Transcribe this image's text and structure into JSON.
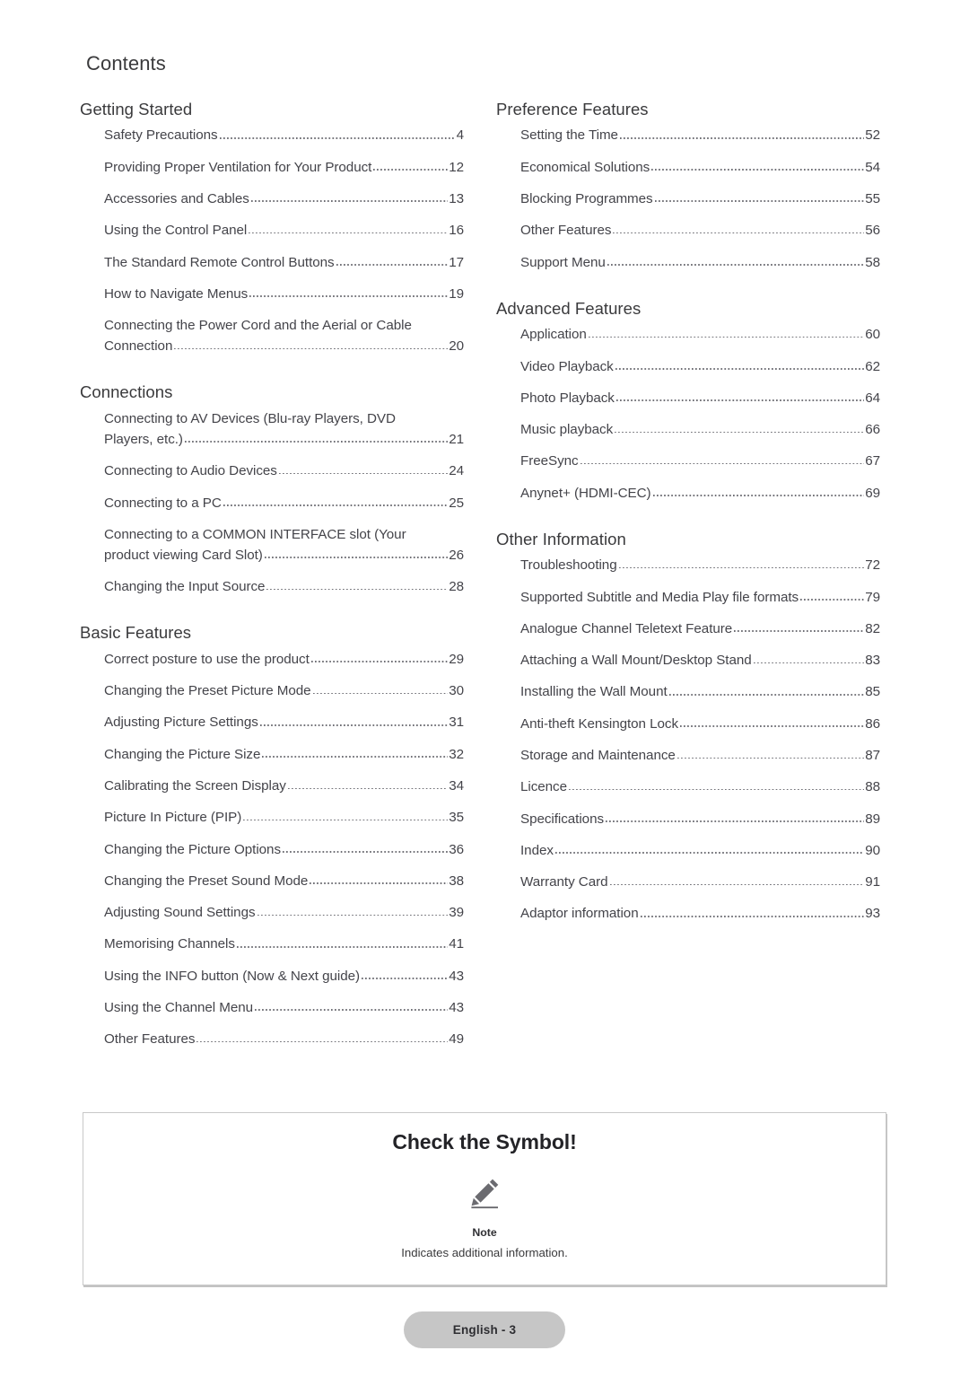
{
  "page": {
    "heading": "Contents",
    "footer_label": "English - 3"
  },
  "toc": {
    "left_column": [
      {
        "title": "Getting Started",
        "entries": [
          {
            "label": "Safety Precautions",
            "page": "4"
          },
          {
            "label": "Providing Proper Ventilation for Your Product",
            "page": "12"
          },
          {
            "label": "Accessories and Cables",
            "page": "13"
          },
          {
            "label": "Using the Control Panel",
            "page": "16"
          },
          {
            "label": "The Standard Remote Control Buttons",
            "page": "17"
          },
          {
            "label": "How to Navigate Menus",
            "page": "19"
          },
          {
            "label": "Connecting the Power Cord and the Aerial or Cable",
            "label2": "Connection",
            "page": "20",
            "wrap": true
          }
        ]
      },
      {
        "title": "Connections",
        "entries": [
          {
            "label": "Connecting to AV Devices (Blu-ray Players, DVD",
            "label2": "Players, etc.)",
            "page": "21",
            "wrap": true
          },
          {
            "label": "Connecting to Audio Devices",
            "page": "24"
          },
          {
            "label": "Connecting to a PC",
            "page": "25"
          },
          {
            "label": "Connecting to a COMMON INTERFACE slot (Your",
            "label2": "product viewing Card Slot)",
            "page": "26",
            "wrap": true
          },
          {
            "label": "Changing the Input Source",
            "page": "28"
          }
        ]
      },
      {
        "title": "Basic Features",
        "entries": [
          {
            "label": "Correct posture to use the product",
            "page": "29"
          },
          {
            "label": "Changing the Preset Picture Mode",
            "page": "30"
          },
          {
            "label": "Adjusting Picture Settings",
            "page": "31"
          },
          {
            "label": "Changing the Picture Size",
            "page": "32"
          },
          {
            "label": "Calibrating the Screen Display",
            "page": "34"
          },
          {
            "label": "Picture In Picture (PIP)",
            "page": "35"
          },
          {
            "label": "Changing the Picture Options",
            "page": "36"
          },
          {
            "label": "Changing the Preset Sound Mode",
            "page": "38"
          },
          {
            "label": "Adjusting Sound Settings",
            "page": "39"
          },
          {
            "label": "Memorising Channels",
            "page": "41"
          },
          {
            "label": "Using the INFO button (Now & Next guide)",
            "page": "43"
          },
          {
            "label": "Using the Channel Menu",
            "page": "43"
          },
          {
            "label": "Other Features",
            "page": "49"
          }
        ]
      }
    ],
    "right_column": [
      {
        "title": "Preference Features",
        "entries": [
          {
            "label": "Setting the Time",
            "page": "52"
          },
          {
            "label": "Economical Solutions",
            "page": "54"
          },
          {
            "label": "Blocking Programmes",
            "page": "55"
          },
          {
            "label": "Other Features",
            "page": "56"
          },
          {
            "label": "Support Menu",
            "page": "58"
          }
        ]
      },
      {
        "title": "Advanced Features",
        "entries": [
          {
            "label": "Application",
            "page": "60"
          },
          {
            "label": "Video Playback",
            "page": "62"
          },
          {
            "label": "Photo Playback",
            "page": "64"
          },
          {
            "label": "Music playback",
            "page": "66"
          },
          {
            "label": "FreeSync",
            "page": "67"
          },
          {
            "label": "Anynet+ (HDMI-CEC)",
            "page": "69"
          }
        ]
      },
      {
        "title": "Other Information",
        "entries": [
          {
            "label": "Troubleshooting",
            "page": "72"
          },
          {
            "label": "Supported Subtitle and Media Play file formats",
            "page": "79"
          },
          {
            "label": "Analogue Channel Teletext Feature",
            "page": "82"
          },
          {
            "label": "Attaching a Wall Mount/Desktop Stand",
            "page": "83"
          },
          {
            "label": "Installing the Wall Mount",
            "page": "85"
          },
          {
            "label": "Anti-theft Kensington Lock",
            "page": "86"
          },
          {
            "label": "Storage and Maintenance",
            "page": "87"
          },
          {
            "label": "Licence",
            "page": "88"
          },
          {
            "label": "Specifications",
            "page": "89"
          },
          {
            "label": "Index",
            "page": "90"
          },
          {
            "label": "Warranty Card",
            "page": "91"
          },
          {
            "label": "Adaptor information",
            "page": "93"
          }
        ]
      }
    ]
  },
  "symbol_box": {
    "title": "Check the Symbol!",
    "icon": "pencil-note-icon",
    "note_label": "Note",
    "note_description": "Indicates additional information.",
    "icon_color": "#6b6b70"
  }
}
